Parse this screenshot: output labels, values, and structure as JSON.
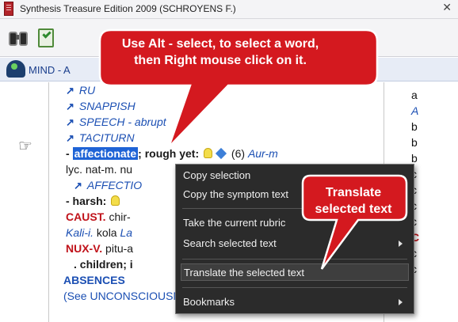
{
  "window": {
    "title": "Synthesis Treasure Edition 2009 (SCHROYENS F.)",
    "close_glyph": "✕"
  },
  "section": {
    "title": "MIND - A"
  },
  "document": {
    "xrefs": [
      "RUDENESS",
      "SNAPPISH",
      "SPEECH - abrupt",
      "TACITURN"
    ],
    "xref_partial": [
      "RU",
      "SNAPPISH",
      "SPEECH - abrupt",
      "TACITURN"
    ],
    "selected_word": "affectionate",
    "line_affectionate_rest": "; rough yet:",
    "count": "(6)",
    "remedy_aur": "Aur-m",
    "remedies_line": "lyc. nat-m. nu",
    "xref_affection": "AFFECTIO",
    "harsh_label": "- harsh:",
    "caust": "CAUST.",
    "caust_rest": " chir-",
    "kali": "Kali-i.",
    "kola": " kola ",
    "la": "La",
    "nuxv": "NUX-V.",
    "nuxv_rest": " pitu-a",
    "children": ". children; i",
    "absences": "ABSENCES",
    "see_line": "(See UNCONSCIOUSNESS - frequent spells of"
  },
  "right_pane": {
    "lines": [
      "a",
      "A",
      "b",
      "b",
      "b",
      "c",
      "c",
      "c",
      "c",
      "C",
      "c",
      "c"
    ]
  },
  "context_menu": {
    "items": [
      {
        "label": "Copy selection",
        "submenu": false
      },
      {
        "label": "Copy the symptom text",
        "submenu": false
      },
      {
        "label": "Take the current rubric",
        "submenu": false
      },
      {
        "label": "Search selected text",
        "submenu": true
      },
      {
        "label": "Translate the selected text",
        "submenu": false,
        "highlighted": true
      },
      {
        "label": "Bookmarks",
        "submenu": true
      }
    ]
  },
  "callouts": {
    "top_line1": "Use Alt - select, to select a word,",
    "top_line2": "then Right mouse click on it.",
    "right_line1": "Translate",
    "right_line2": "selected text",
    "color": "#d4191f"
  },
  "icons": {
    "app": "book-icon",
    "binoculars": "binoculars-icon",
    "notebook": "notebook-check-icon",
    "head": "head-icon",
    "pointer": "pointing-hand-icon",
    "bulb": "lightbulb-icon",
    "diamond": "diamond-icon"
  }
}
